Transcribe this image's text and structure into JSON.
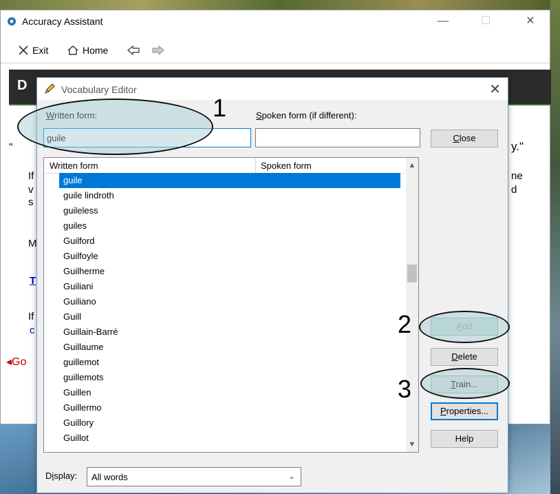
{
  "app": {
    "title": "Accuracy Assistant",
    "controls": {
      "minimize": "—",
      "maximize": "☐",
      "close": "✕"
    },
    "toolbar": {
      "exit_label": "Exit",
      "home_label": "Home"
    },
    "background": {
      "heading_fragment": "D",
      "quote_left": "\"",
      "quote_right": "y.\"",
      "line1_left": "If",
      "line1_right": "ne",
      "line2_left": "v",
      "line2_right": "d",
      "line3_left": "s",
      "line4_left": "M",
      "link_fragment": "T",
      "line5_left": "If",
      "line6_left": "c",
      "go_fragment": "◂Go"
    }
  },
  "dialog": {
    "title": "Vocabulary Editor",
    "written_label": "Written form:",
    "written_value": "guile",
    "spoken_label": "Spoken form (if different):",
    "spoken_value": "",
    "list_headers": {
      "written": "Written form",
      "spoken": "Spoken form"
    },
    "words": [
      "guile",
      "guile lindroth",
      "guileless",
      "guiles",
      "Guilford",
      "Guilfoyle",
      "Guilherme",
      "Guiliani",
      "Guiliano",
      "Guill",
      "Guillain-Barré",
      "Guillaume",
      "guillemot",
      "guillemots",
      "Guillen",
      "Guillermo",
      "Guillory",
      "Guillot"
    ],
    "buttons": {
      "close": "Close",
      "add": "Add",
      "delete": "Delete",
      "train": "Train...",
      "properties": "Properties...",
      "help": "Help"
    },
    "display_label": "Display:",
    "display_value": "All words"
  },
  "annotations": {
    "n1": "1",
    "n2": "2",
    "n3": "3"
  },
  "colors": {
    "selection": "#0078d7",
    "annotation_fill": "#a0cdd2"
  }
}
